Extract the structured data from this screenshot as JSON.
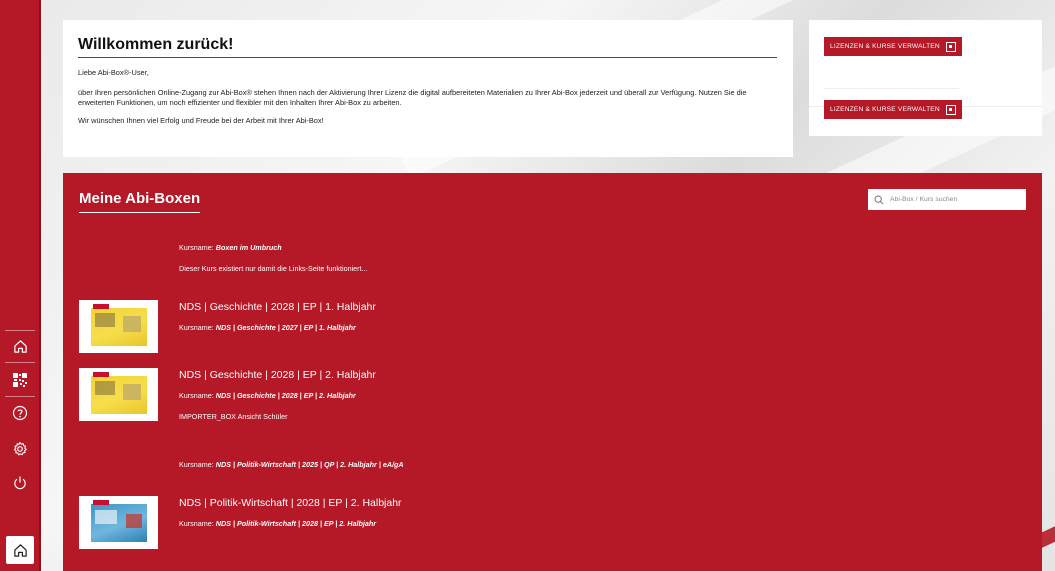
{
  "welcome": {
    "title": "Willkommen zurück!",
    "greeting": "Liebe Abi-Box®-User,",
    "paragraph": "über Ihren persönlichen Online-Zugang zur Abi-Box® stehen Ihnen nach der Aktivierung Ihrer Lizenz die digital aufbereiteten Materialien zu Ihrer Abi-Box jederzeit und überall zur Verfügung. Nutzen Sie die erweiterten Funktionen, um noch effizienter und flexibler mit den Inhalten Ihrer Abi-Box zu arbeiten.",
    "closing": "Wir wünschen Ihnen viel Erfolg und Freude bei der Arbeit mit Ihrer Abi-Box!"
  },
  "licenses": {
    "button_top": "LIZENZEN & KURSE VERWALTEN",
    "button_bottom": "LIZENZEN & KURSE VERWALTEN"
  },
  "boxes": {
    "title": "Meine Abi-Boxen",
    "search_placeholder": "Abi-Box / Kurs suchen",
    "course_prefix": "Kursname:",
    "items": [
      {
        "title": "",
        "course": "Boxen im Umbruch",
        "note": "Dieser Kurs existiert nur damit die Links-Seite funktioniert..."
      },
      {
        "title": "NDS | Geschichte | 2028 | EP | 1. Halbjahr",
        "course": "NDS | Geschichte | 2027 | EP | 1. Halbjahr",
        "note": ""
      },
      {
        "title": "NDS | Geschichte | 2028 | EP | 2. Halbjahr",
        "course": "NDS | Geschichte | 2028 | EP | 2. Halbjahr",
        "note": "IMPORTER_BOX Ansicht Schüler"
      },
      {
        "title": "",
        "course": "NDS | Politik-Wirtschaft | 2025 | QP | 2. Halbjahr | eA/gA",
        "note": ""
      },
      {
        "title": "NDS | Politik-Wirtschaft | 2028 | EP | 2. Halbjahr",
        "course": "NDS | Politik-Wirtschaft | 2028 | EP | 2. Halbjahr",
        "note": ""
      }
    ]
  },
  "sidebar": {
    "icons": [
      "home-icon",
      "qr-code-icon",
      "help-icon",
      "settings-icon",
      "power-icon",
      "home-icon"
    ]
  },
  "colors": {
    "brand_red": "#b51826",
    "white": "#ffffff"
  }
}
